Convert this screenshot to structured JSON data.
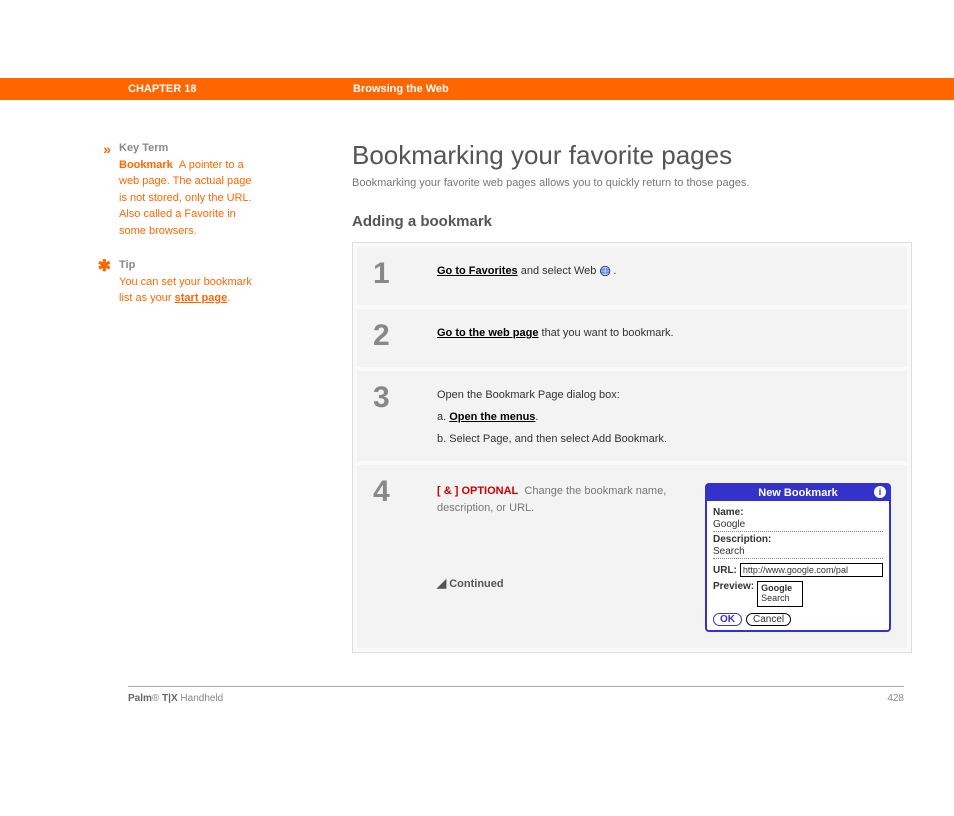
{
  "header": {
    "chapter": "CHAPTER 18",
    "title": "Browsing the Web"
  },
  "sidebar": {
    "keyterm": {
      "marker": "»",
      "label": "Key Term",
      "term": "Bookmark",
      "text": "A pointer to a web page. The actual page is not stored, only the URL. Also called a Favorite in some browsers."
    },
    "tip": {
      "marker": "✱",
      "label": "Tip",
      "text": "You can set your bookmark list as your ",
      "link": "start page",
      "after": "."
    }
  },
  "main": {
    "h1": "Bookmarking your favorite pages",
    "intro": "Bookmarking your favorite web pages allows you to quickly return to those pages.",
    "h2": "Adding a bookmark",
    "steps": {
      "s1": {
        "num": "1",
        "link": "Go to Favorites",
        "after": " and select Web ",
        "tail": "."
      },
      "s2": {
        "num": "2",
        "link": "Go to the web page",
        "after": " that you want to bookmark."
      },
      "s3": {
        "num": "3",
        "intro": "Open the Bookmark Page dialog box:",
        "a_prefix": "a.  ",
        "a_link": "Open the menus",
        "a_tail": ".",
        "b": "b.  Select Page, and then select Add Bookmark."
      },
      "s4": {
        "num": "4",
        "tag": "[ & ]  OPTIONAL",
        "text": "Change the bookmark name, description, or URL.",
        "continued": "Continued"
      }
    }
  },
  "dialog": {
    "title": "New Bookmark",
    "name_label": "Name:",
    "name_value": "Google",
    "desc_label": "Description:",
    "desc_value": "Search",
    "url_label": "URL:",
    "url_value": "http://www.google.com/pal",
    "preview_label": "Preview:",
    "preview_line1": "Google",
    "preview_line2": "Search",
    "ok": "OK",
    "cancel": "Cancel"
  },
  "footer": {
    "product_bold": "Palm",
    "product_reg": "®",
    "product_model": " T|X",
    "product_tail": " Handheld",
    "page": "428"
  }
}
